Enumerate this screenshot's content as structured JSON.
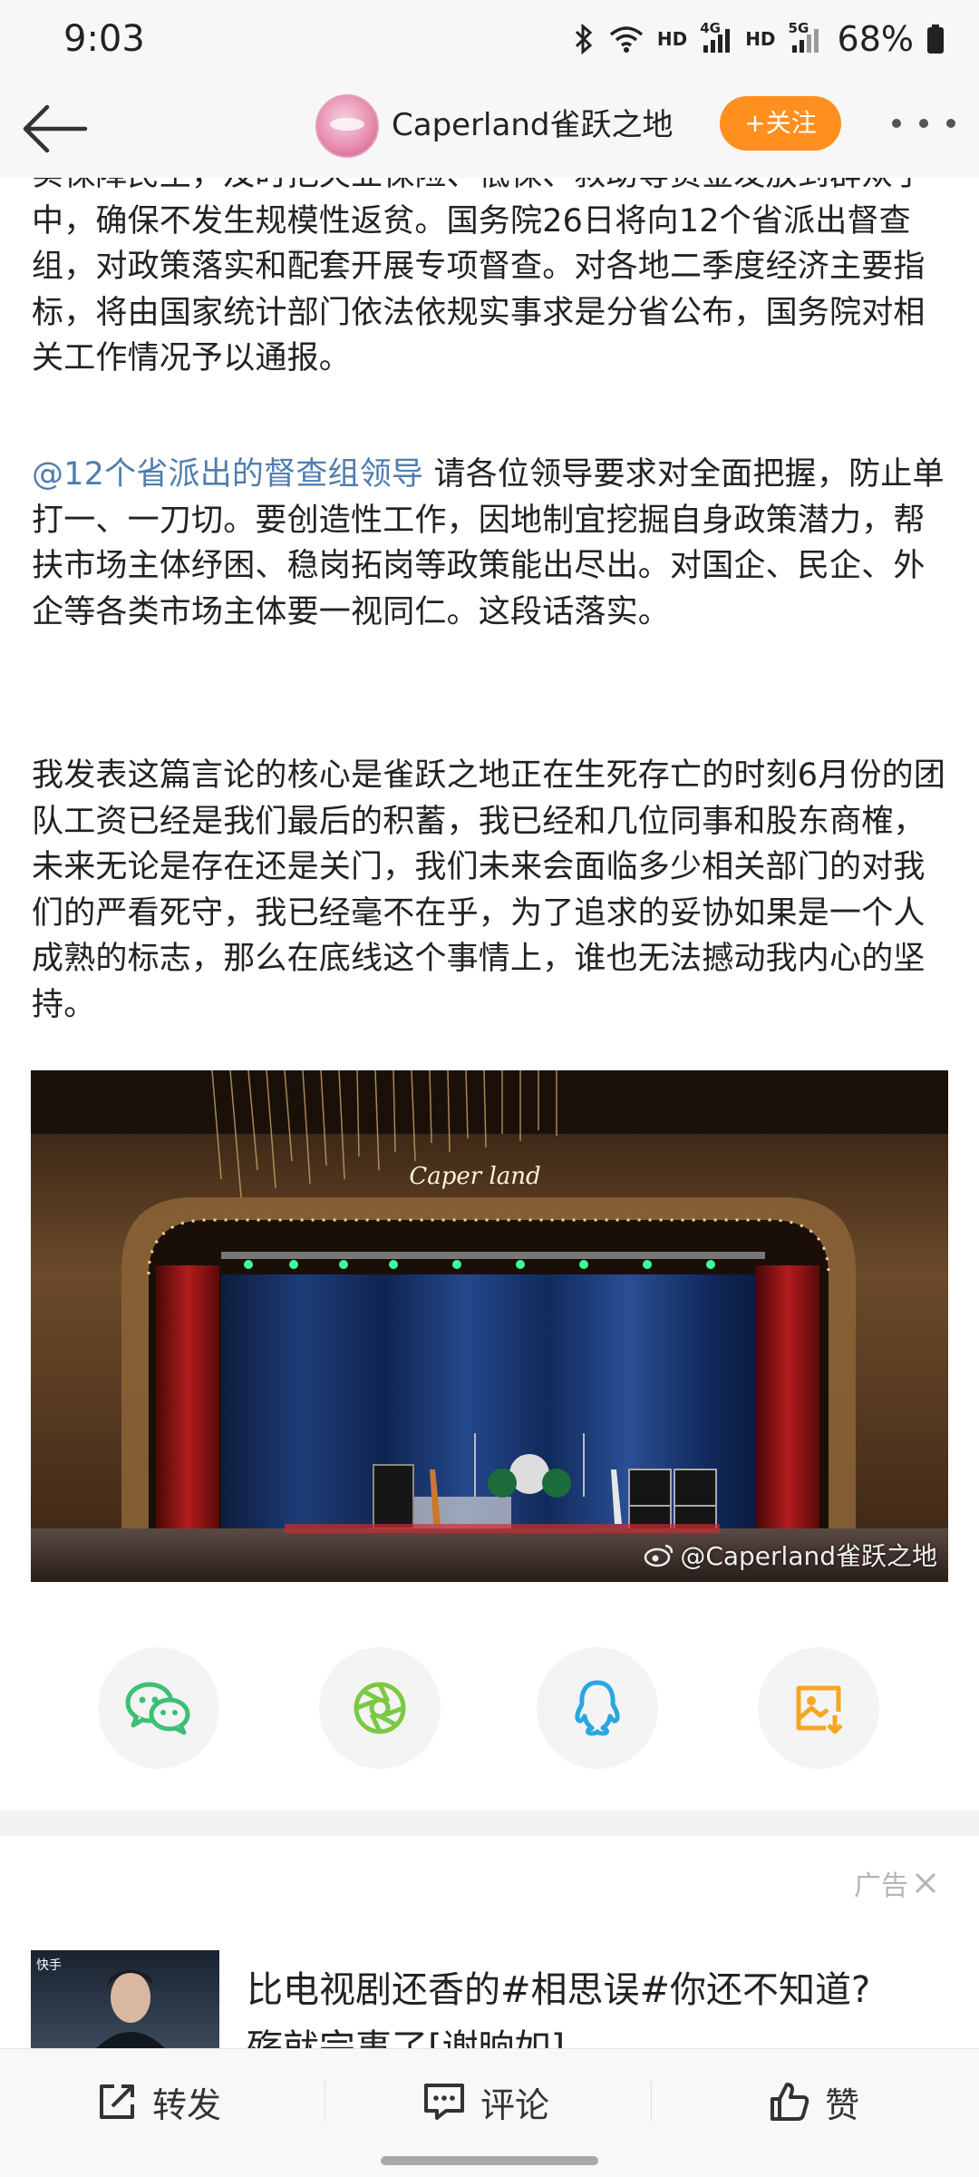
{
  "status_bar": {
    "time": "9:03",
    "network_label_1": "HD",
    "network_gen_1": "4G",
    "network_label_2": "HD",
    "network_gen_2": "5G",
    "battery": "68%"
  },
  "nav": {
    "title": "Caperland雀跃之地",
    "follow_label": "+关注"
  },
  "article": {
    "paragraph_1": "实保障民生，及时把失业保险、低保、救助等资金发放到群众手中，确保不发生规模性返贫。国务院26日将向12个省派出督查组，对政策落实和配套开展专项督查。对各地二季度经济主要指标，将由国家统计部门依法依规实事求是分省公布，国务院对相关工作情况予以通报。",
    "mention": "@12个省派出的督查组领导",
    "paragraph_2": " 请各位领导要求对全面把握，防止单打一、一刀切。要创造性工作，因地制宜挖掘自身政策潜力，帮扶市场主体纾困、稳岗拓岗等政策能出尽出。对国企、民企、外企等各类市场主体要一视同仁。这段话落实。",
    "paragraph_3": "我发表这篇言论的核心是雀跃之地正在生死存亡的时刻6月份的团队工资已经是我们最后的积蓄，我已经和几位同事和股东商榷，未来无论是存在还是关门，我们未来会面临多少相关部门的对我们的严看死守，我已经毫不在乎，为了追求的妥协如果是一个人成熟的标志，那么在底线这个事情上，谁也无法撼动我内心的坚持。",
    "image_watermark": "@Caperland雀跃之地",
    "stage_sign": "Caper land"
  },
  "share": {
    "items": [
      {
        "icon": "wechat-icon"
      },
      {
        "icon": "moments-icon"
      },
      {
        "icon": "qq-icon"
      },
      {
        "icon": "save-image-icon"
      }
    ]
  },
  "ad": {
    "label": "广告",
    "thumb_logo": "快手",
    "title_line_1": "比电视剧还香的#相思误#你还不知道?",
    "title_line_2": "殇就完事了[谢晌如]"
  },
  "actions": {
    "repost": "转发",
    "comment": "评论",
    "like": "赞"
  },
  "colors": {
    "follow_button": "#ff8f1e",
    "mention_link": "#507daf",
    "wechat_green": "#3dbf78",
    "moments_green": "#7ac943",
    "qq_blue": "#2aa6e0",
    "save_orange": "#f5a623"
  }
}
